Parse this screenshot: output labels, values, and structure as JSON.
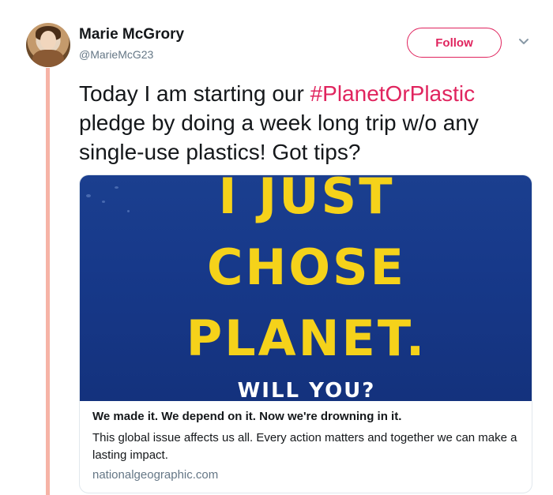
{
  "tweet": {
    "user": {
      "name": "Marie McGrory",
      "handle": "@MarieMcG23",
      "avatar_icon": "user-avatar"
    },
    "follow_label": "Follow",
    "menu_icon": "chevron-down-icon",
    "text_before": "Today I am starting our ",
    "hashtag": "#PlanetOrPlastic",
    "text_after": " pledge by doing a week long trip w/o any single-use plastics! Got tips?",
    "accent_color": "#e0245e"
  },
  "card": {
    "image": {
      "line1": "I JUST",
      "line2": "CHOSE",
      "line3": "PLANET.",
      "subline": "WILL YOU?",
      "text_color": "#f5d21a",
      "background_color": "#17398a"
    },
    "title": "We made it. We depend on it. Now we're drowning in it.",
    "description": "This global issue affects us all. Every action matters and together we can make a lasting impact.",
    "domain": "nationalgeographic.com"
  }
}
